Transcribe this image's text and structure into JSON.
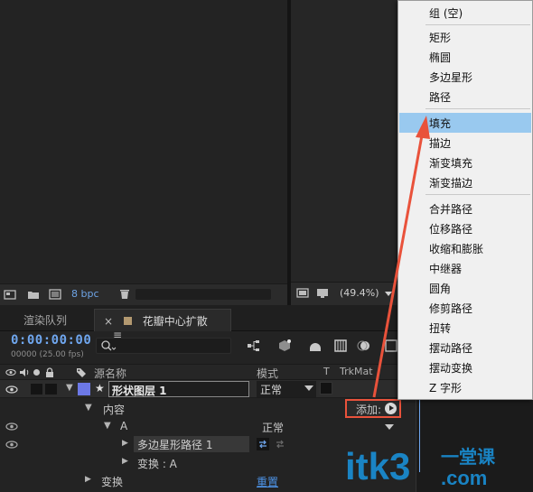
{
  "project": {
    "bpc": "8 bpc"
  },
  "composition": {
    "zoom": "(49.4%)"
  },
  "tabs": {
    "render_queue": "渲染队列",
    "comp_close": "×",
    "comp_name": "花瓣中心扩散",
    "comp_menu": "≡"
  },
  "timeline": {
    "timecode": "0:00:00:00",
    "fps": "00000 (25.00 fps)",
    "search_placeholder": ""
  },
  "columns": {
    "source_name": "源名称",
    "mode": "模式",
    "t": "T",
    "trkmat": "TrkMat"
  },
  "layers": {
    "layer_name": "形状图层 1",
    "layer_mode": "正常",
    "contents_label": "内容",
    "add_label": "添加:",
    "group_a_label": "A",
    "group_a_mode": "正常",
    "polystar_path": "多边星形路径 1",
    "transform_a": "变换 : A",
    "transform_label": "变换",
    "reset_link": "重置"
  },
  "menu": {
    "items": [
      "组 (空)",
      "矩形",
      "椭圆",
      "多边星形",
      "路径",
      "填充",
      "描边",
      "渐变填充",
      "渐变描边",
      "合并路径",
      "位移路径",
      "收缩和膨胀",
      "中继器",
      "圆角",
      "修剪路径",
      "扭转",
      "摆动路径",
      "摆动变换",
      "Z 字形"
    ],
    "selected_index": 5
  },
  "watermark": {
    "text_latin": "itk3",
    "text_cn": "一堂课",
    "text_com": ".com"
  },
  "colors": {
    "accent_blue": "#6fa6ee",
    "highlight_red": "#e9523b",
    "menu_selection": "#99c9ef",
    "watermark_blue": "#1a8fd6"
  }
}
